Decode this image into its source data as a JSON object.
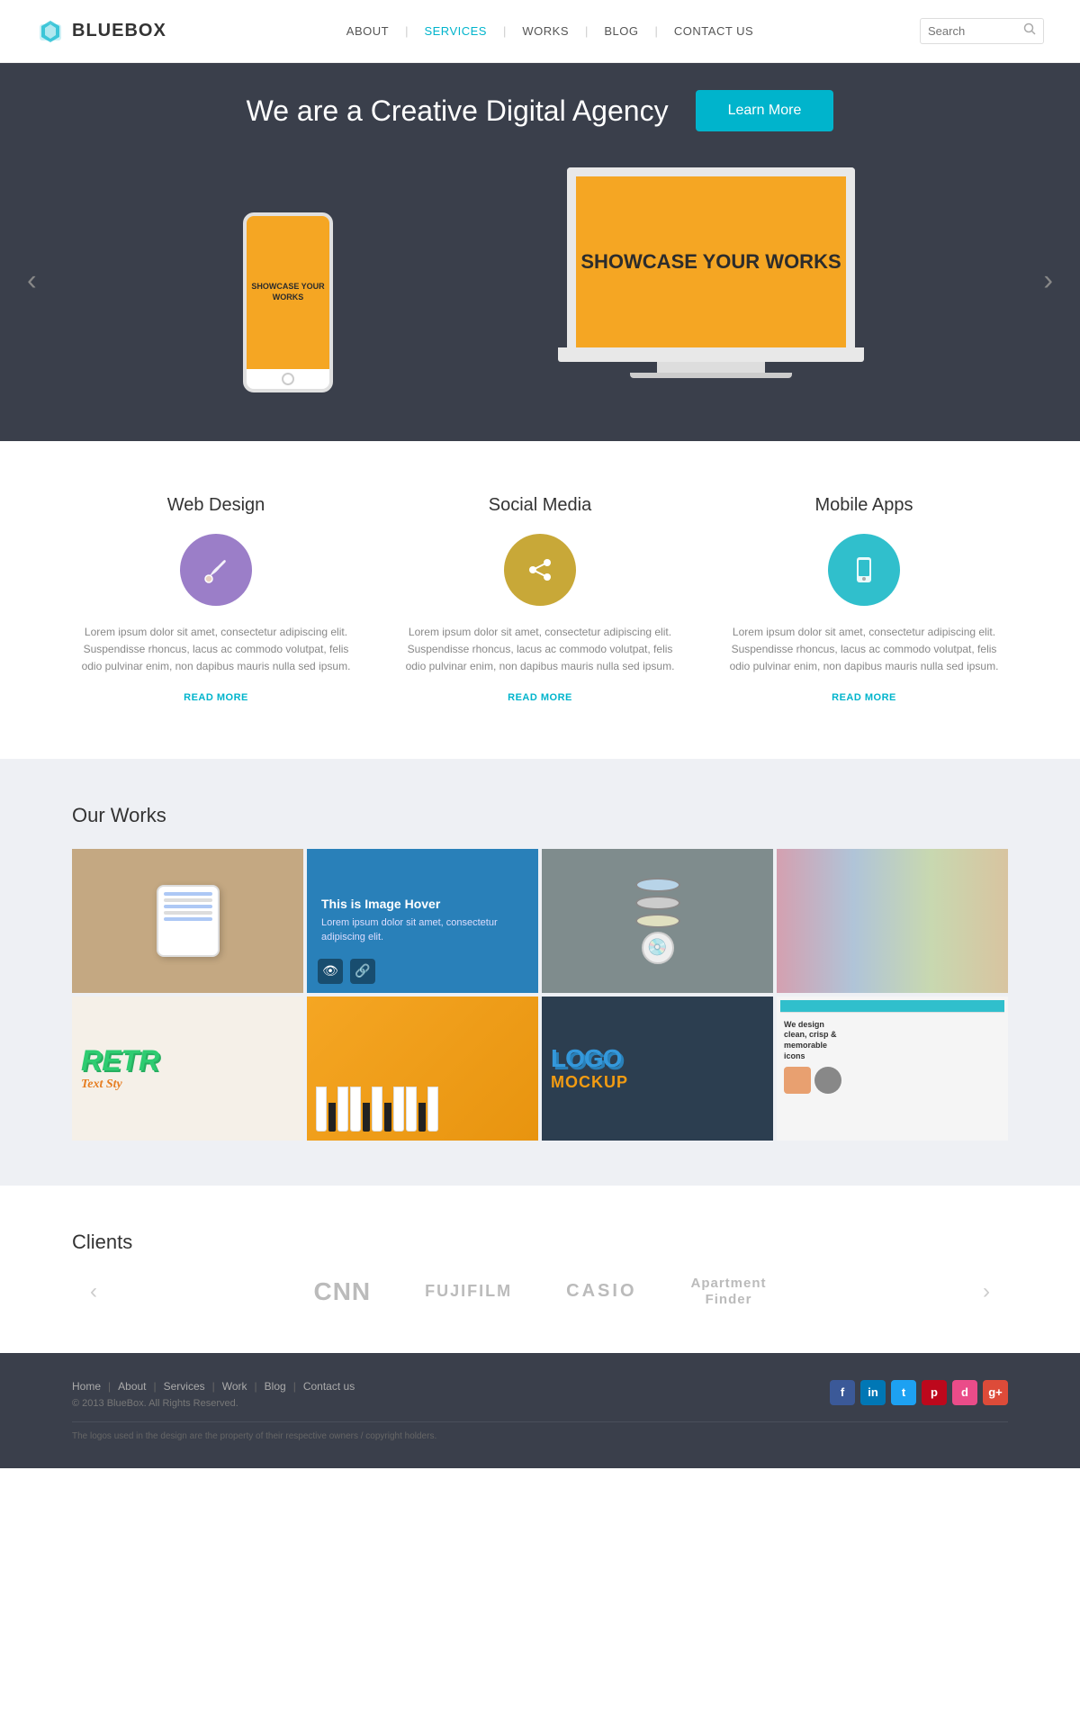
{
  "header": {
    "logo_text": "BLUEBOX",
    "nav_items": [
      {
        "label": "ABOUT",
        "active": false
      },
      {
        "label": "SERVICES",
        "active": true
      },
      {
        "label": "WORKS",
        "active": false
      },
      {
        "label": "BLOG",
        "active": false
      },
      {
        "label": "CONTACT US",
        "active": false
      }
    ],
    "search_placeholder": "Search"
  },
  "hero": {
    "title": "We are a Creative Digital Agency",
    "learn_more": "Learn More",
    "showcase_text_laptop": "SHOWCASE YOUR WORKS",
    "showcase_text_phone": "SHOWCASE YOUR WORKS",
    "arrow_left": "‹",
    "arrow_right": "›"
  },
  "services": {
    "items": [
      {
        "title": "Web Design",
        "icon_color": "purple",
        "desc": "Lorem ipsum dolor sit amet, consectetur adipiscing elit. Suspendisse rhoncus, lacus ac commodo volutpat, felis odio pulvinar enim, non dapibus mauris nulla sed ipsum.",
        "read_more": "READ MORE"
      },
      {
        "title": "Social Media",
        "icon_color": "yellow",
        "desc": "Lorem ipsum dolor sit amet, consectetur adipiscing elit. Suspendisse rhoncus, lacus ac commodo volutpat, felis odio pulvinar enim, non dapibus mauris nulla sed ipsum.",
        "read_more": "READ MORE"
      },
      {
        "title": "Mobile Apps",
        "icon_color": "teal",
        "desc": "Lorem ipsum dolor sit amet, consectetur adipiscing elit. Suspendisse rhoncus, lacus ac commodo volutpat, felis odio pulvinar enim, non dapibus mauris nulla sed ipsum.",
        "read_more": "READ MORE"
      }
    ]
  },
  "our_works": {
    "title": "Our Works",
    "hover_title": "This is Image Hover",
    "hover_desc": "Lorem ipsum dolor sit amet, consectetur adipiscing elit."
  },
  "clients": {
    "title": "Clients",
    "logos": [
      "CNN",
      "FUJIFILM",
      "CASIO",
      "Apartment\nFinder"
    ]
  },
  "footer": {
    "nav_items": [
      "Home",
      "About",
      "Services",
      "Work",
      "Blog",
      "Contact us"
    ],
    "copyright": "© 2013 BlueBox. All Rights Reserved.",
    "legal": "The logos used in the design are the property of their respective owners / copyright holders.",
    "social": [
      "f",
      "in",
      "t",
      "p",
      "d",
      "g+"
    ]
  }
}
